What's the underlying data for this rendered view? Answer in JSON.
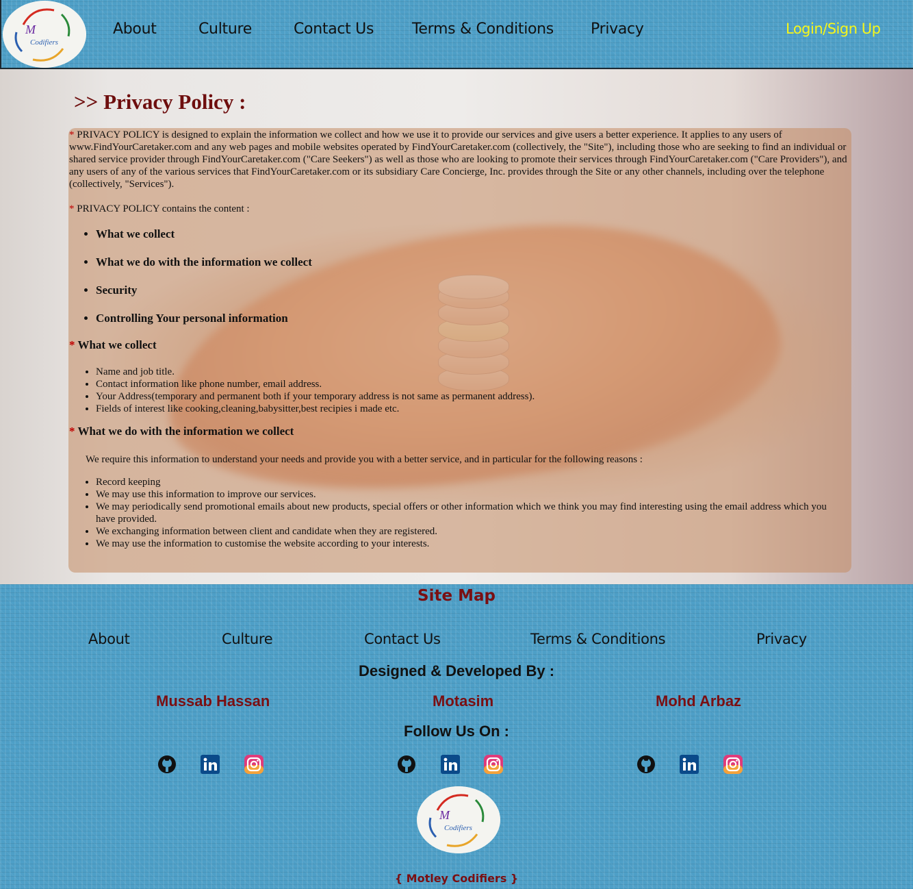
{
  "header": {
    "logo_alt": "{M Codifiers}",
    "nav": [
      "About",
      "Culture",
      "Contact Us",
      "Terms & Conditions",
      "Privacy"
    ],
    "login": "Login/Sign Up"
  },
  "main": {
    "heading": ">> Privacy Policy :",
    "intro": "PRIVACY POLICY is designed to explain the information we collect and how we use it to provide our services and give users a better experience. It applies to any users of www.FindYourCaretaker.com and any web pages and mobile websites operated by FindYourCaretaker.com (collectively, the \"Site\"), including those who are seeking to find an individual or shared service provider through FindYourCaretaker.com (\"Care Seekers\") as well as those who are looking to promote their services through FindYourCaretaker.com (\"Care Providers\"), and any users of any of the various services that FindYourCaretaker.com or its subsidiary Care Concierge, Inc. provides through the Site or any other channels, including over the telephone (collectively, \"Services\").",
    "contains": "PRIVACY POLICY contains the content :",
    "topics": [
      "What we collect",
      "What we do with the information we collect",
      "Security",
      "Controlling Your personal information"
    ],
    "collect_title": "What we collect",
    "collect_items": [
      "Name and job title.",
      "Contact information like phone number, email address.",
      "Your Address(temporary and permanent both if your temporary address is not same as permanent address).",
      "Fields of interest like cooking,cleaning,babysitter,best recipies i made etc."
    ],
    "use_title": "What we do with the information we collect",
    "use_intro": "We require this information to understand your needs and provide you with a better service, and in particular for the following reasons :",
    "use_items": [
      "Record keeping",
      "We may use this information to improve our services.",
      "We may periodically send promotional emails about new products, special offers or other information which we think you may find interesting using the email address which you have provided.",
      "We exchanging information between client and candidate when they are registered.",
      "We may use the information to customise the website according to your interests."
    ]
  },
  "footer": {
    "sitemap_title": "Site Map",
    "links": [
      "About",
      "Culture",
      "Contact Us",
      "Terms & Conditions",
      "Privacy"
    ],
    "designed_by": "Designed & Developed By :",
    "developers": [
      "Mussab Hassan",
      "Motasim",
      "Mohd Arbaz"
    ],
    "follow": "Follow Us On :",
    "social_icons": [
      "github-icon",
      "linkedin-icon",
      "instagram-icon"
    ],
    "brand": "{ Motley Codifiers }"
  },
  "colors": {
    "header_bg": "#4e9fc7",
    "heading": "#6e0e0e",
    "login": "#f6f61a",
    "developer_name": "#7a0f12",
    "asterisk": "#c00000"
  }
}
